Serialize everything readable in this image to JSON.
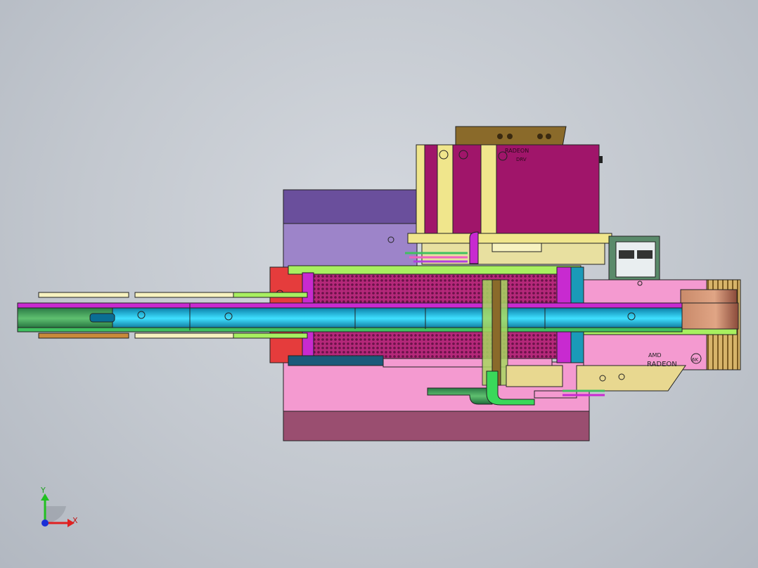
{
  "viewport": {
    "background_top": "#d4d8de",
    "background_bottom": "#b2b8c1"
  },
  "model": {
    "gpu_brand_line1": "AMD",
    "gpu_brand_line2": "RADEON",
    "gpu_badge": "6K",
    "cooler_label_line1": "RADEON",
    "cooler_label_line2": "DRV"
  },
  "triad": {
    "x_label": "X",
    "y_label": "Y",
    "x_color": "#e02020",
    "y_color": "#20c020",
    "origin_color": "#1a2fd6"
  }
}
